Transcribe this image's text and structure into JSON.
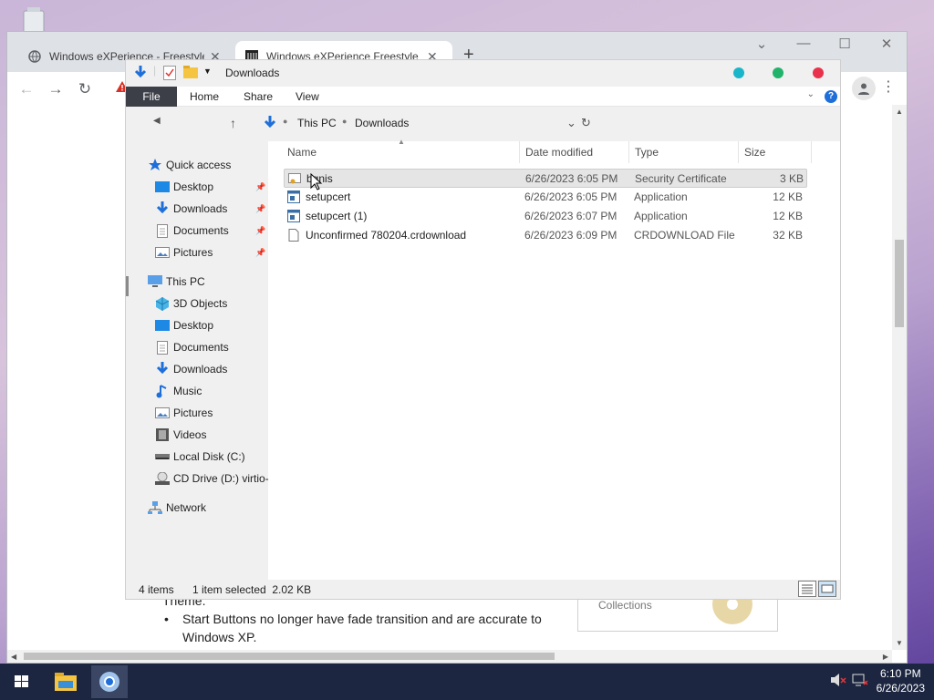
{
  "browser": {
    "tabs": [
      {
        "title": "Windows eXPerience - Freestyle U",
        "icon": "globe-icon",
        "active": false
      },
      {
        "title": "Windows eXPerience Freestyle Up",
        "icon": "site-icon",
        "active": true
      }
    ],
    "new_tab": "+"
  },
  "explorer": {
    "quick_access_title": "Downloads",
    "ribbon_tabs": [
      "File",
      "Home",
      "Share",
      "View"
    ],
    "help": "?",
    "breadcrumb": [
      "This PC",
      "Downloads"
    ],
    "nav": {
      "quick_access": "Quick access",
      "quick_items": [
        "Desktop",
        "Downloads",
        "Documents",
        "Pictures"
      ],
      "this_pc": "This PC",
      "pc_items": [
        "3D Objects",
        "Desktop",
        "Documents",
        "Downloads",
        "Music",
        "Pictures",
        "Videos",
        "Local Disk (C:)",
        "CD Drive (D:) virtio-"
      ],
      "network": "Network"
    },
    "columns": [
      "Name",
      "Date modified",
      "Type",
      "Size"
    ],
    "files": [
      {
        "name": "bgnis",
        "date": "6/26/2023 6:05 PM",
        "type": "Security Certificate",
        "size": "3 KB",
        "icon": "certificate-icon",
        "selected": true
      },
      {
        "name": "setupcert",
        "date": "6/26/2023 6:05 PM",
        "type": "Application",
        "size": "12 KB",
        "icon": "application-icon",
        "selected": false
      },
      {
        "name": "setupcert (1)",
        "date": "6/26/2023 6:07 PM",
        "type": "Application",
        "size": "12 KB",
        "icon": "application-icon",
        "selected": false
      },
      {
        "name": "Unconfirmed 780204.crdownload",
        "date": "6/26/2023 6:09 PM",
        "type": "CRDOWNLOAD File",
        "size": "32 KB",
        "icon": "file-icon",
        "selected": false
      }
    ],
    "status": {
      "items": "4 items",
      "selected": "1 item selected  2.02 KB"
    }
  },
  "webpage": {
    "line1": "Theme.",
    "bullet1": "Start Buttons no longer have fade transition and are accurate to Windows XP.",
    "card_text": "Collections"
  },
  "taskbar": {
    "time": "6:10 PM",
    "date": "6/26/2023"
  },
  "colors": {
    "dot_teal": "#1ab5c9",
    "dot_green": "#22b36b",
    "dot_red": "#e8314a",
    "taskbar": "#1c2640"
  }
}
